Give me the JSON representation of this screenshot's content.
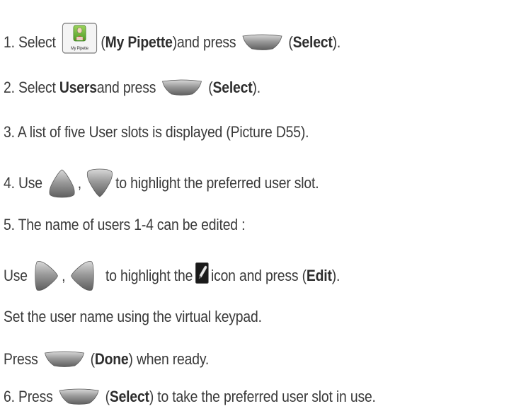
{
  "steps": {
    "s1": {
      "num": "1. Select",
      "name": "My Pipette",
      "mid": " and press ",
      "action": "Select",
      "end": ").",
      "open": " (",
      "open2": "(",
      "icon_label": "My Pipette"
    },
    "s2": {
      "pre": "2. Select ",
      "bold": "Users",
      "mid": " and press",
      "open": "(",
      "action": "Select",
      "end": ")."
    },
    "s3": {
      "text": "3. A list of five User slots is displayed (Picture D55)."
    },
    "s4": {
      "pre": "4. Use",
      "comma": ",",
      "post": " to highlight the preferred user slot."
    },
    "s5": {
      "text": "5. The name of users 1-4 can be edited :"
    },
    "s5b": {
      "pre": "Use",
      "comma": ",",
      "mid": "to highlight the",
      "post": " icon and press (",
      "action": "Edit",
      "end": ")."
    },
    "s5c": {
      "text": "Set the user name using the virtual keypad."
    },
    "s5d": {
      "pre": "Press",
      "open": "(",
      "action": "Done",
      "end": ") when ready."
    },
    "s6": {
      "pre": "6. Press",
      "open": "(",
      "action": "Select",
      "end": ") to take the preferred user slot in use."
    }
  },
  "icons": {
    "my_pipette": "my-pipette-icon",
    "select_key": "select-softkey-icon",
    "up_key": "up-arrow-key-icon",
    "down_key": "down-arrow-key-icon",
    "right_key": "right-arrow-key-icon",
    "left_key": "left-arrow-key-icon",
    "edit": "edit-pencil-icon"
  },
  "colors": {
    "text": "#3a3a3a",
    "key_gray": "#8a8a8a",
    "icon_green": "#6fb23a"
  }
}
